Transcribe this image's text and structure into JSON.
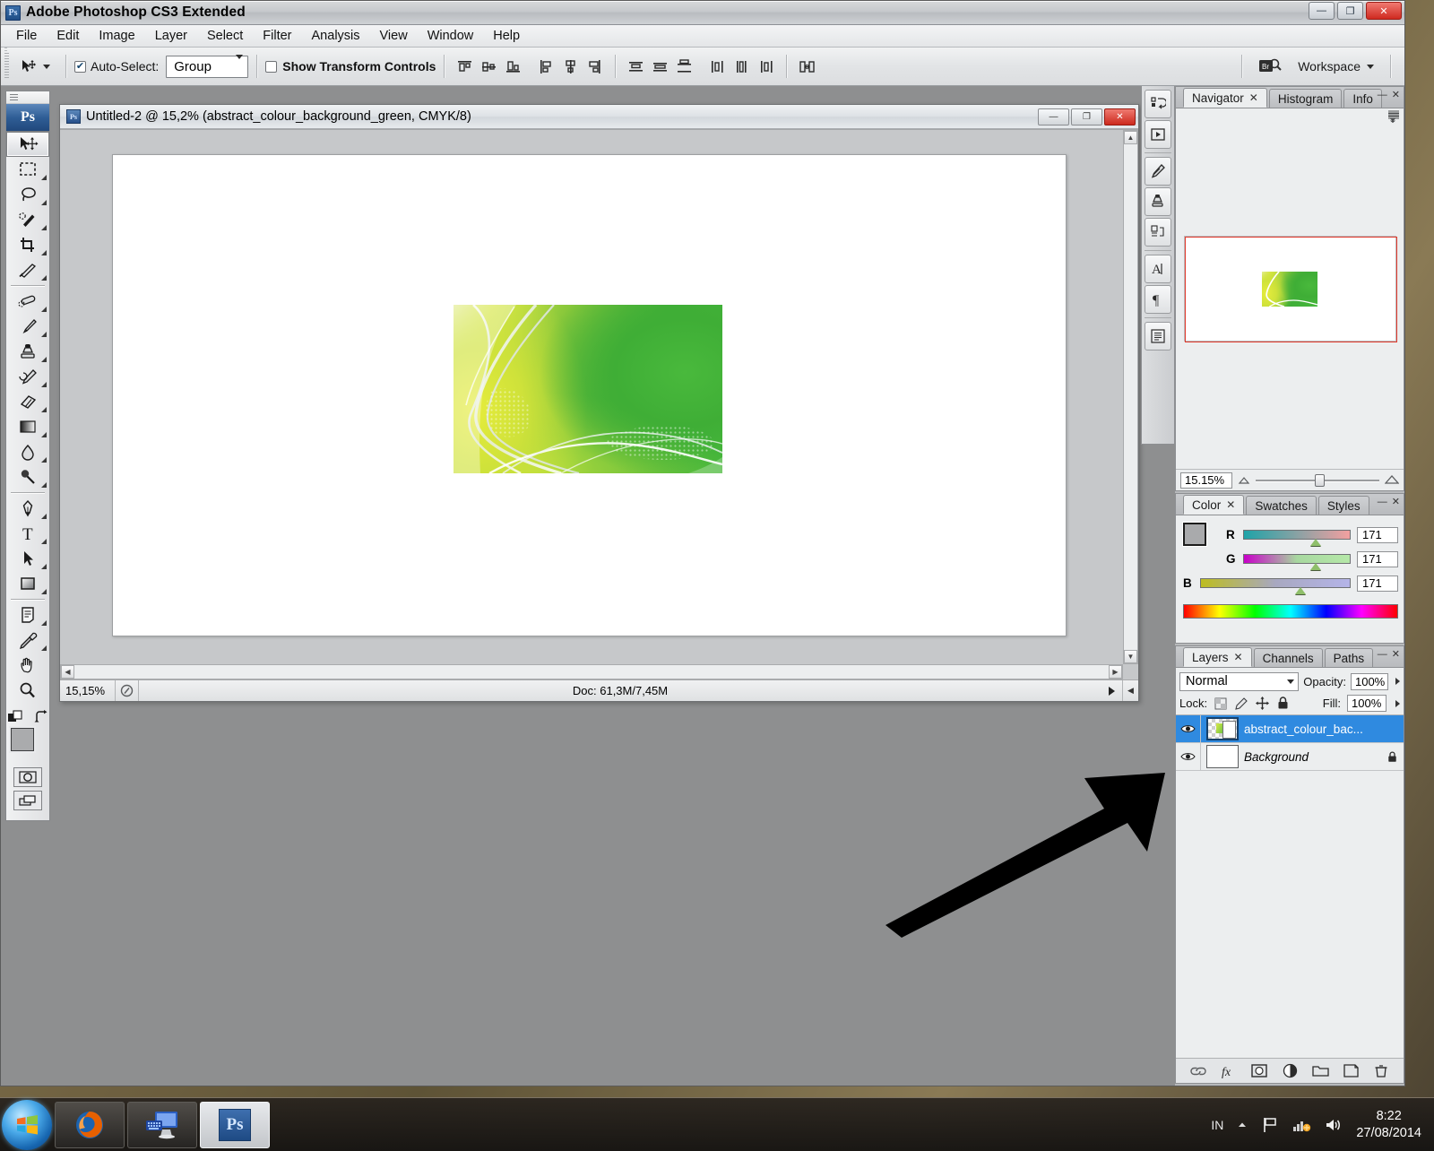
{
  "app": {
    "title": "Adobe Photoshop CS3 Extended",
    "logo_text": "Ps"
  },
  "window_controls": {
    "minimize": "—",
    "maximize": "❐",
    "close": "✕"
  },
  "menu": {
    "items": [
      {
        "label": "File"
      },
      {
        "label": "Edit"
      },
      {
        "label": "Image"
      },
      {
        "label": "Layer"
      },
      {
        "label": "Select"
      },
      {
        "label": "Filter"
      },
      {
        "label": "Analysis"
      },
      {
        "label": "View"
      },
      {
        "label": "Window"
      },
      {
        "label": "Help"
      }
    ]
  },
  "options_bar": {
    "auto_select_label": "Auto-Select:",
    "auto_select_checked": true,
    "group_value": "Group",
    "show_transform_label": "Show Transform Controls",
    "show_transform_checked": false,
    "workspace_label": "Workspace",
    "align_left_edges": "align-left-edges",
    "align_horizontal_centers": "align-horizontal-centers",
    "align_right_edges": "align-right-edges",
    "align_top_edges": "align-top-edges",
    "align_vertical_centers": "align-vertical-centers",
    "align_bottom_edges": "align-bottom-edges",
    "distribute_top": "distribute-top-edges",
    "distribute_vcenter": "distribute-vertical-centers",
    "distribute_bottom": "distribute-bottom-edges",
    "distribute_left": "distribute-left-edges",
    "distribute_hcenter": "distribute-horizontal-centers",
    "distribute_right": "distribute-right-edges",
    "auto_align": "auto-align-layers"
  },
  "toolbox": {
    "tools": [
      {
        "name": "move-tool",
        "active": true
      },
      {
        "name": "rectangular-marquee-tool",
        "active": false
      },
      {
        "name": "lasso-tool",
        "active": false
      },
      {
        "name": "quick-selection-tool",
        "active": false
      },
      {
        "name": "crop-tool",
        "active": false
      },
      {
        "name": "slice-tool",
        "active": false
      },
      {
        "name": "spot-healing-brush-tool",
        "active": false
      },
      {
        "name": "brush-tool",
        "active": false
      },
      {
        "name": "clone-stamp-tool",
        "active": false
      },
      {
        "name": "history-brush-tool",
        "active": false
      },
      {
        "name": "eraser-tool",
        "active": false
      },
      {
        "name": "gradient-tool",
        "active": false
      },
      {
        "name": "blur-tool",
        "active": false
      },
      {
        "name": "dodge-tool",
        "active": false
      },
      {
        "name": "pen-tool",
        "active": false
      },
      {
        "name": "horizontal-type-tool",
        "active": false
      },
      {
        "name": "path-selection-tool",
        "active": false
      },
      {
        "name": "rectangle-tool",
        "active": false
      },
      {
        "name": "notes-tool",
        "active": false
      },
      {
        "name": "eyedropper-tool",
        "active": false
      },
      {
        "name": "hand-tool",
        "active": false
      },
      {
        "name": "zoom-tool",
        "active": false
      }
    ],
    "foreground_color": "#aaabad",
    "background_color": "#ffffff"
  },
  "document": {
    "title": "Untitled-2 @ 15,2% (abstract_colour_background_green, CMYK/8)",
    "status": {
      "zoom": "15,15%",
      "doc_size": "Doc: 61,3M/7,45M"
    },
    "window_controls": {
      "minimize": "—",
      "maximize": "❐",
      "close": "✕"
    }
  },
  "navigator": {
    "tabs": [
      {
        "label": "Navigator",
        "active": true,
        "closable": true
      },
      {
        "label": "Histogram",
        "active": false,
        "closable": false
      },
      {
        "label": "Info",
        "active": false,
        "closable": false
      }
    ],
    "zoom_value": "15.15%"
  },
  "color_panel": {
    "tabs": [
      {
        "label": "Color",
        "active": true,
        "closable": true
      },
      {
        "label": "Swatches",
        "active": false,
        "closable": false
      },
      {
        "label": "Styles",
        "active": false,
        "closable": false
      }
    ],
    "channels": [
      {
        "label": "R",
        "value": "171"
      },
      {
        "label": "G",
        "value": "171"
      },
      {
        "label": "B",
        "value": "171"
      }
    ]
  },
  "layers_panel": {
    "tabs": [
      {
        "label": "Layers",
        "active": true,
        "closable": true
      },
      {
        "label": "Channels",
        "active": false,
        "closable": false
      },
      {
        "label": "Paths",
        "active": false,
        "closable": false
      }
    ],
    "blend_mode": "Normal",
    "opacity_label": "Opacity:",
    "opacity_value": "100%",
    "lock_label": "Lock:",
    "fill_label": "Fill:",
    "fill_value": "100%",
    "layers": [
      {
        "name": "abstract_colour_bac...",
        "selected": true,
        "visible": true,
        "locked": false,
        "italic": false
      },
      {
        "name": "Background",
        "selected": false,
        "visible": true,
        "locked": true,
        "italic": true
      }
    ],
    "bottom_buttons": [
      {
        "name": "link-layers-icon"
      },
      {
        "name": "layer-style-fx-icon"
      },
      {
        "name": "add-layer-mask-icon"
      },
      {
        "name": "adjustment-layer-icon"
      },
      {
        "name": "new-group-folder-icon"
      },
      {
        "name": "new-layer-icon"
      },
      {
        "name": "delete-layer-trash-icon"
      }
    ]
  },
  "dock_rail": {
    "buttons": [
      {
        "name": "tool-presets-icon"
      },
      {
        "name": "animation-icon"
      },
      {
        "name": "brushes-icon"
      },
      {
        "name": "clone-source-icon"
      },
      {
        "name": "measurement-log-icon"
      },
      {
        "name": "character-icon"
      },
      {
        "name": "paragraph-icon"
      },
      {
        "name": "layer-comps-icon"
      }
    ]
  },
  "taskbar": {
    "start_label": "start-orb",
    "items": [
      {
        "name": "firefox-taskbar-item",
        "active": false
      },
      {
        "name": "explorer-taskbar-item",
        "active": false
      },
      {
        "name": "photoshop-taskbar-item",
        "active": true,
        "label": "Ps"
      }
    ],
    "tray": {
      "language": "IN",
      "time": "8:22",
      "date": "27/08/2014"
    }
  },
  "colors": {
    "accent_blue": "#2f8ae0",
    "title_close_red": "#cc2a1e",
    "navigator_view_box": "#e33b2e",
    "artwork_green": "#3fae38",
    "artwork_yellow": "#dbe94a"
  }
}
